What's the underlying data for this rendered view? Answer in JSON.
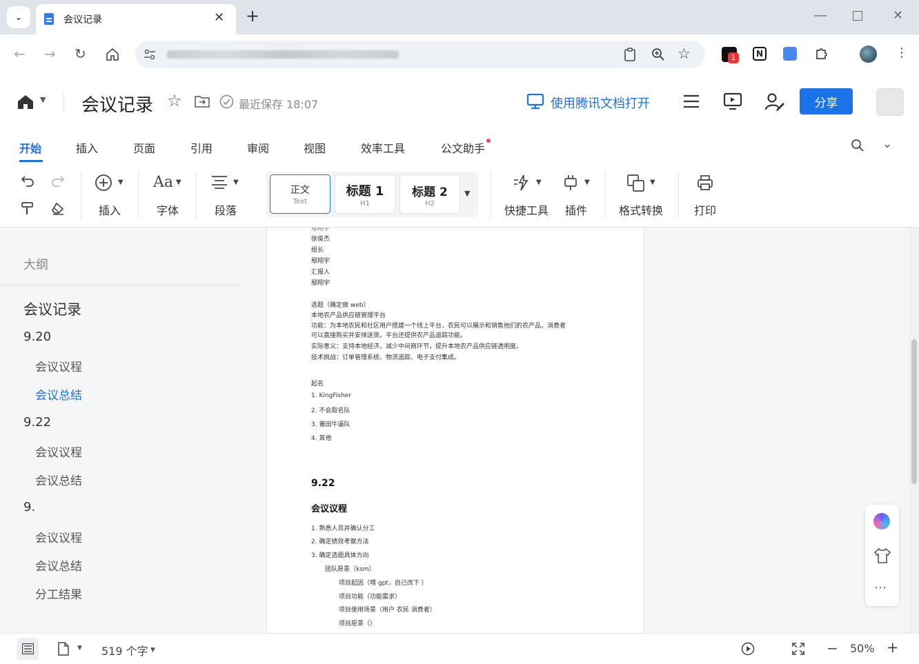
{
  "browser": {
    "tab_title": "会议记录",
    "tab_close": "✕",
    "new_tab": "+",
    "notion_badge": "N",
    "ext_badge_count": "1"
  },
  "header": {
    "doc_title": "会议记录",
    "save_status": "最近保存 18:07",
    "open_tencent": "使用腾讯文档打开",
    "share": "分享"
  },
  "menu": {
    "tabs": [
      "开始",
      "插入",
      "页面",
      "引用",
      "审阅",
      "视图",
      "效率工具",
      "公文助手"
    ]
  },
  "toolbar": {
    "insert": "插入",
    "font": "字体",
    "paragraph": "段落",
    "styles": [
      {
        "title": "正文",
        "sub": "Text"
      },
      {
        "title": "标题 1",
        "sub": "H1"
      },
      {
        "title": "标题 2",
        "sub": "H2"
      }
    ],
    "quick_tools": "快捷工具",
    "plugins": "插件",
    "format_convert": "格式转换",
    "print": "打印"
  },
  "outline": {
    "heading": "大纲",
    "items": [
      {
        "label": "会议记录",
        "level": 1
      },
      {
        "label": "9.20",
        "level": 2
      },
      {
        "label": "会议议程",
        "level": 3
      },
      {
        "label": "会议总结",
        "level": 3,
        "active": true
      },
      {
        "label": "9.22",
        "level": 2
      },
      {
        "label": "会议议程",
        "level": 3
      },
      {
        "label": "会议总结",
        "level": 3
      },
      {
        "label": "9.",
        "level": 2
      },
      {
        "label": "会议议程",
        "level": 3
      },
      {
        "label": "会议总结",
        "level": 3
      },
      {
        "label": "分工结果",
        "level": 3
      }
    ]
  },
  "document": {
    "lines_top": [
      "徐俊杰",
      "组长",
      "鄢翔宇",
      "汇报人",
      "鄢翔宇"
    ],
    "topic": [
      "选题（确定做 web）",
      "本地农产品供应链管理平台",
      "功能：为本地农民和社区用户搭建一个线上平台，农民可以展示和销售他们的农产品，消费者",
      "可以直接购买并安排送货。平台还提供农产品追踪功能。",
      "实际意义：支持本地经济，减少中间商环节，提升本地农产品供应链透明度。",
      "技术挑战：订单管理系统、物流追踪、电子支付集成。"
    ],
    "naming_label": "起名",
    "naming": [
      "1.  KingFisher",
      "2.  不会取名队",
      "3.  莆田牛逼队",
      "4.  其他"
    ],
    "h_date": "9.22",
    "h_agenda": "会议议程",
    "agenda": [
      "1.  熟悉人员并确认分工",
      "2.  确定绩效考察方法",
      "3.  确定选题具体方向"
    ],
    "sub1": "团队愿景（ksm）",
    "sub2": [
      "项目起因（喂 gpt，自己改下 ）",
      "项目功能（功能需求）",
      "项目使用场景（用户  农民  消费者）",
      "项目愿景（）"
    ]
  },
  "status": {
    "word_count": "519 个字",
    "zoom": "50%"
  }
}
